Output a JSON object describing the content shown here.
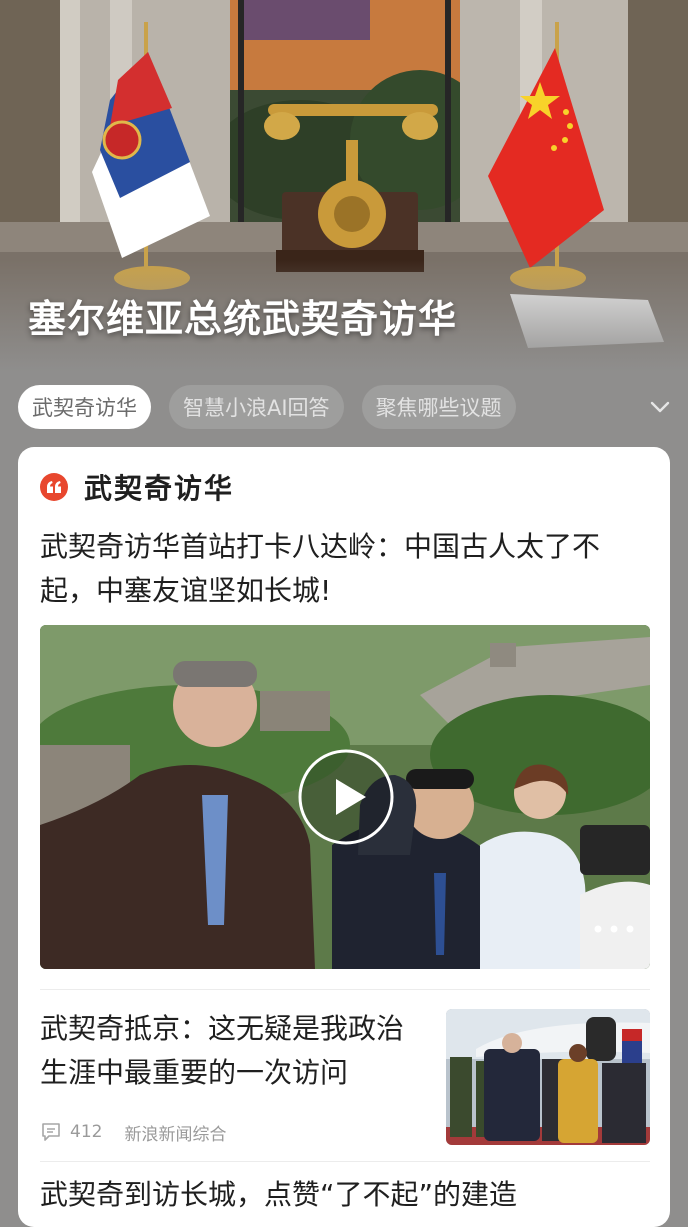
{
  "hero": {
    "title": "塞尔维亚总统武契奇访华"
  },
  "tabs": [
    {
      "label": "武契奇访华",
      "active": true
    },
    {
      "label": "智慧小浪AI回答",
      "active": false
    },
    {
      "label": "聚焦哪些议题",
      "active": false
    }
  ],
  "card": {
    "heading": "武契奇访华",
    "lead": {
      "title": "武契奇访华首站打卡八达岭：中国古人太了不起，中塞友谊坚如长城!"
    },
    "items": [
      {
        "title": "武契奇抵京：这无疑是我政治生涯中最重要的一次访问",
        "comments": "412",
        "source": "新浪新闻综合"
      },
      {
        "title": "武契奇到访长城，点赞“了不起”的建造"
      }
    ]
  },
  "colors": {
    "page_bg": "#8f8e8d",
    "accent": "#e8472e",
    "card_bg": "#ffffff",
    "text": "#1f1f1f",
    "meta": "#9a9a9a"
  },
  "icons": {
    "tabs_expand": "chevron-down-icon",
    "heading_badge": "quote-icon",
    "video_play": "play-icon",
    "video_more": "more-dots-icon",
    "comments": "comment-icon"
  }
}
